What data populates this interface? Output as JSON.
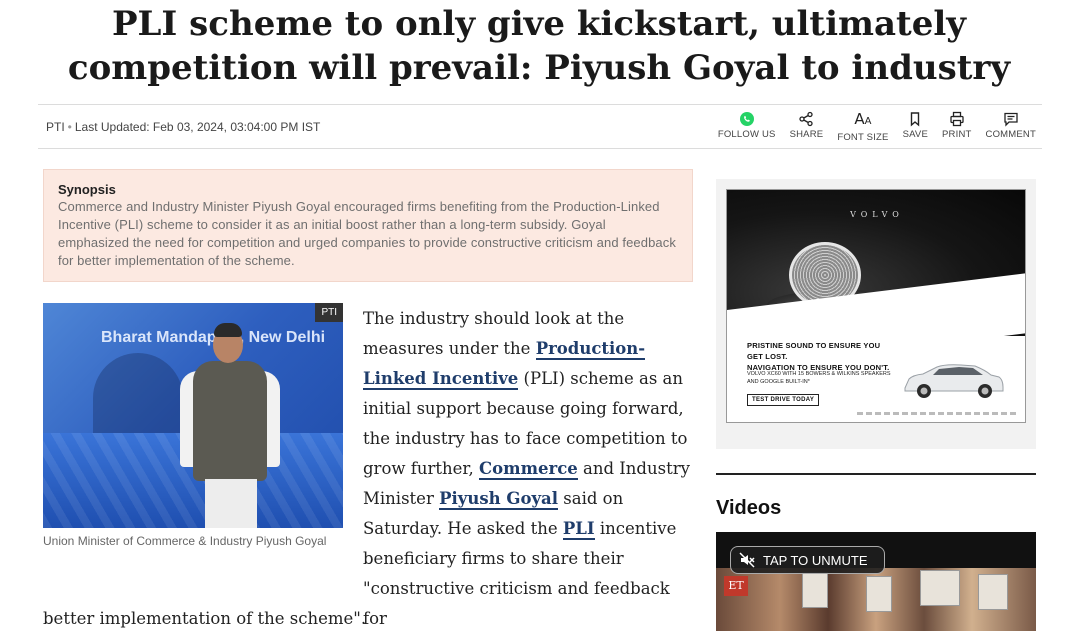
{
  "article": {
    "headline": "PLI scheme to only give kickstart, ultimately competition will prevail: Piyush Goyal to industry",
    "source": "PTI",
    "updated": "Last Updated: Feb 03, 2024, 03:04:00 PM IST",
    "synopsis_title": "Synopsis",
    "synopsis_text": "Commerce and Industry Minister Piyush Goyal encouraged firms benefiting from the Production-Linked Incentive (PLI) scheme to consider it as an initial boost rather than a long-term subsidy. Goyal emphasized the need for competition and urged companies to provide constructive criticism and feedback for better implementation of the scheme.",
    "image_badge": "PTI",
    "image_backdrop_text": "Bharat Mandapam, New Delhi",
    "image_caption": "Union Minister of Commerce & Industry Piyush Goyal",
    "body": {
      "t1": "The industry should look at the measures under the ",
      "link1": "Production-Linked Incentive",
      "t2": " (PLI) scheme as an initial support because going forward, the industry has to face competition to grow further, ",
      "link2": "Commerce",
      "t3": " and Industry Minister ",
      "link3": "Piyush Goyal",
      "t4": " said on Saturday. He asked the ",
      "link4": "PLI",
      "t5": " incentive beneficiary firms to share their \"constructive criticism and feedback for",
      "tail": "better implementation of the scheme\"."
    }
  },
  "toolbar": {
    "follow": "FOLLOW US",
    "share": "SHARE",
    "font_icon_big": "A",
    "font_icon_small": "A",
    "font": "FONT SIZE",
    "save": "SAVE",
    "print": "PRINT",
    "comment": "COMMENT"
  },
  "ad": {
    "brand": "VOLVO",
    "line1": "PRISTINE SOUND TO ENSURE YOU GET LOST.",
    "line2": "NAVIGATION TO ENSURE YOU DON'T.",
    "sub": "VOLVO XC60 WITH 15 BOWERS & WILKINS SPEAKERS AND GOOGLE BUILT-IN*",
    "cta": "TEST DRIVE TODAY"
  },
  "videos": {
    "title": "Videos",
    "unmute": "TAP TO UNMUTE",
    "logo": "ET"
  },
  "colors": {
    "synopsis_bg": "#fce9e1",
    "link": "#1f3d6b",
    "whatsapp": "#25d366"
  },
  "icons": [
    "whatsapp-icon",
    "share-icon",
    "font-size-icon",
    "bookmark-icon",
    "print-icon",
    "comment-icon",
    "muted-speaker-icon"
  ]
}
